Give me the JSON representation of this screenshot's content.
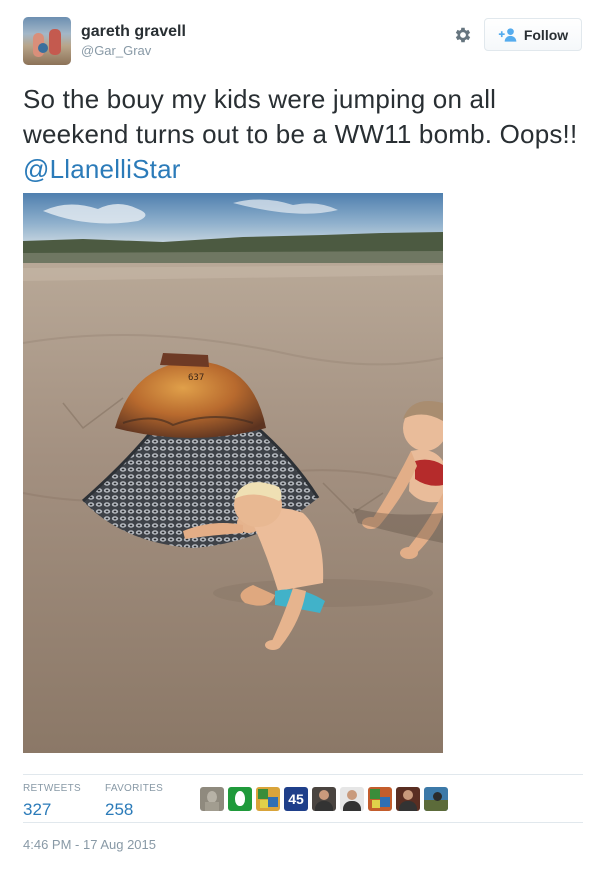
{
  "user": {
    "display_name": "gareth gravell",
    "handle": "@Gar_Grav"
  },
  "actions": {
    "follow_label": "Follow",
    "settings_icon": "gear-icon",
    "follow_icon": "add-user-icon"
  },
  "tweet": {
    "text": "So the bouy my kids were jumping on all weekend turns out to be a WW11 bomb. Oops!!",
    "mention": "@LlanelliStar"
  },
  "photo": {
    "mine_marking": "637"
  },
  "stats": {
    "retweets_label": "RETWEETS",
    "retweets_value": "327",
    "favorites_label": "FAVORITES",
    "favorites_value": "258"
  },
  "favoriters": [
    {
      "kind": "statue",
      "bg": "#8f8a7e"
    },
    {
      "kind": "egg",
      "bg": "#1f9a3b"
    },
    {
      "kind": "colorful",
      "bg": "#d9a43a"
    },
    {
      "kind": "badge",
      "bg": "#1f3f8a",
      "text": "45"
    },
    {
      "kind": "person",
      "bg": "#4a4440"
    },
    {
      "kind": "person",
      "bg": "#e6e6e6"
    },
    {
      "kind": "colorful",
      "bg": "#c35d2c"
    },
    {
      "kind": "person",
      "bg": "#5a2e22"
    },
    {
      "kind": "landscape",
      "bg": "#3c79a8"
    }
  ],
  "timestamp": "4:46 PM - 17 Aug 2015",
  "colors": {
    "link": "#2b7bb9",
    "muted": "#8899a6",
    "text": "#292f33",
    "border": "#e1e8ed"
  }
}
